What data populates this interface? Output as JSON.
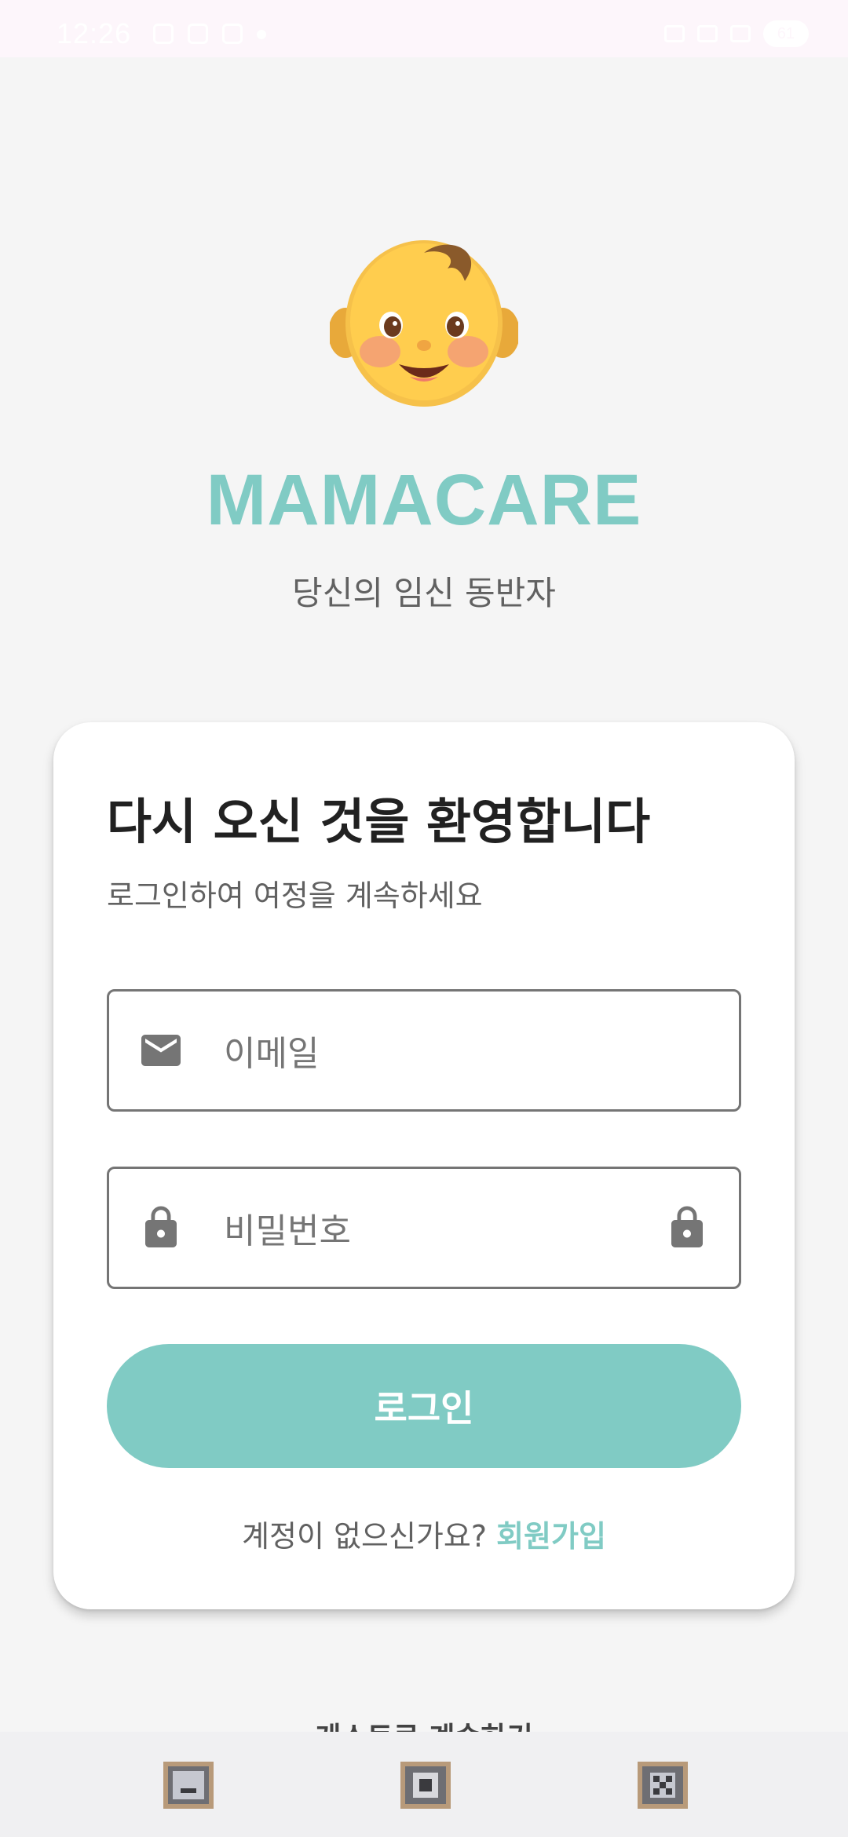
{
  "status_bar": {
    "time": "12:26",
    "battery": "61"
  },
  "app": {
    "name": "MAMACARE",
    "tagline": "당신의 임신 동반자",
    "logo_icon": "baby-face-emoji",
    "brand_color": "#80cbc4"
  },
  "login_card": {
    "title": "다시 오신 것을 환영합니다",
    "subtitle": "로그인하여 여정을 계속하세요",
    "email_field": {
      "placeholder": "이메일",
      "value": "",
      "icon": "mail-icon"
    },
    "password_field": {
      "placeholder": "비밀번호",
      "value": "",
      "icon": "lock-icon",
      "toggle_icon": "lock-icon"
    },
    "login_button_label": "로그인",
    "signup_prompt": "계정이 없으신가요? ",
    "signup_link_label": "회원가입"
  },
  "guest_link_label": "게스트로 계속하기",
  "nav_bar": {
    "back_icon": "back-icon",
    "home_icon": "home-icon",
    "recents_icon": "recents-icon"
  }
}
